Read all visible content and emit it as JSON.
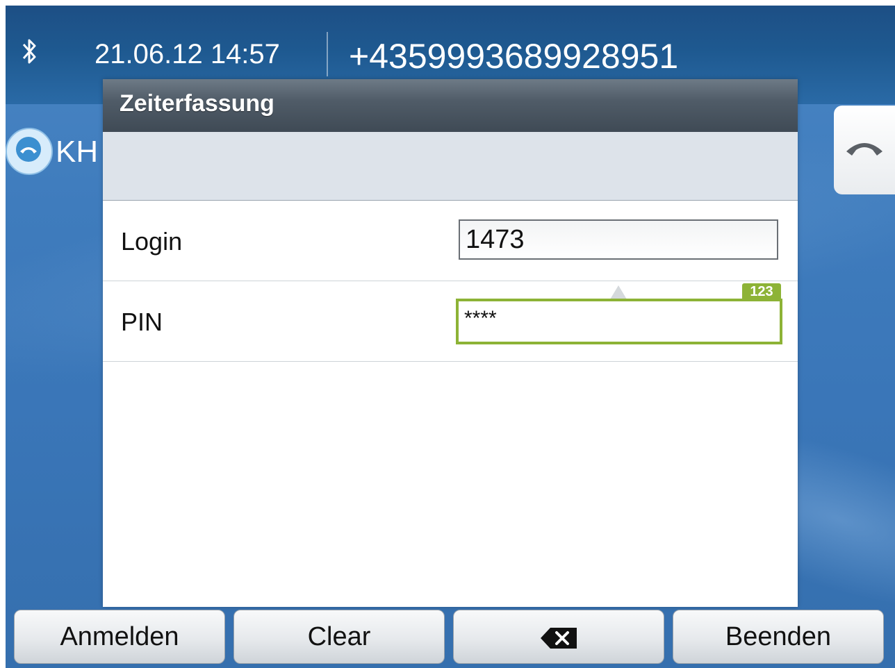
{
  "status_bar": {
    "datetime": "21.06.12 14:57",
    "phone_number": "+4359993689928951",
    "icons": [
      "bluetooth-icon"
    ]
  },
  "background": {
    "line_label": "KH",
    "icons": [
      "handset-icon",
      "handset-icon"
    ]
  },
  "dialog": {
    "title": "Zeiterfassung",
    "fields": [
      {
        "label": "Login",
        "value": "1473"
      },
      {
        "label": "PIN",
        "value": "****",
        "input_mode": "123"
      }
    ]
  },
  "softkeys": [
    {
      "label": "Anmelden"
    },
    {
      "label": "Clear"
    },
    {
      "label": "",
      "icon": "backspace-icon"
    },
    {
      "label": "Beenden"
    }
  ],
  "colors": {
    "status_bar": "#1e5990",
    "title_bar": "#505c68",
    "focus_border": "#8db336"
  }
}
